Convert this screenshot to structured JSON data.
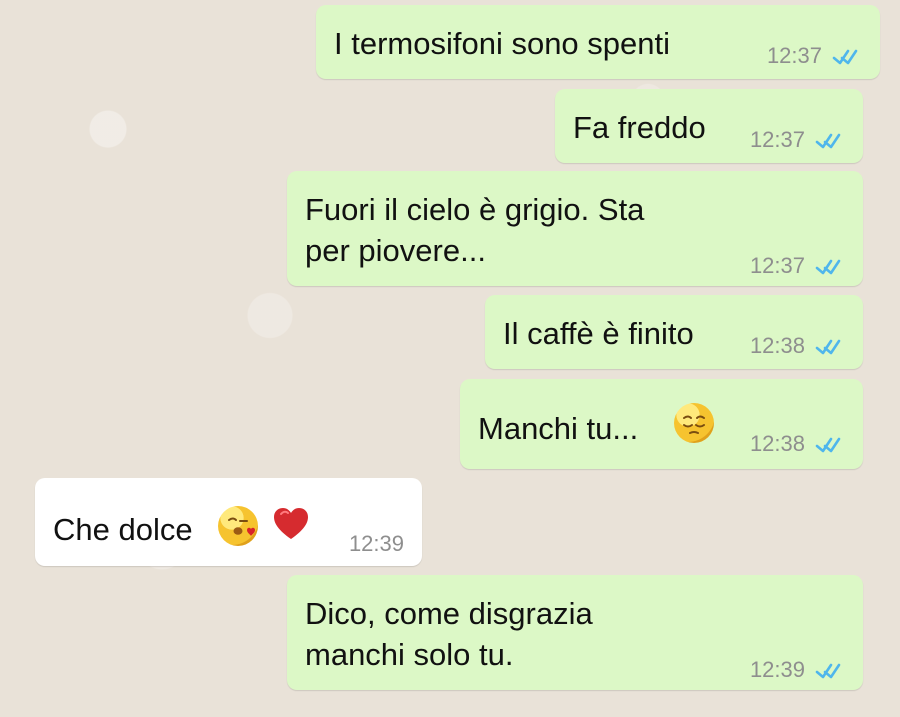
{
  "messages": [
    {
      "text": "I termosifoni sono spenti",
      "time": "12:37",
      "icon": "double-check-icon"
    },
    {
      "text": "Fa freddo",
      "time": "12:37",
      "icon": "double-check-icon"
    },
    {
      "line1": "Fuori il cielo è grigio. Sta",
      "line2": "per piovere...",
      "time": "12:37",
      "icon": "double-check-icon"
    },
    {
      "text": "Il caffè è finito",
      "time": "12:38",
      "icon": "double-check-icon"
    },
    {
      "text": "Manchi tu...",
      "time": "12:38",
      "emoji": "pensive-face-emoji",
      "icon": "double-check-icon"
    },
    {
      "text": "Che dolce",
      "time": "12:39",
      "emoji": [
        "kissing-heart-emoji",
        "red-heart-emoji"
      ]
    },
    {
      "line1": "Dico, come disgrazia",
      "line2": "manchi solo tu.",
      "time": "12:39",
      "icon": "double-check-icon"
    }
  ],
  "colors": {
    "outgoing_bubble": "#dcf8c6",
    "incoming_bubble": "#ffffff",
    "timestamp": "#8e8e8e",
    "read_ticks": "#4fb6ec",
    "chat_background": "#e9e2d8"
  }
}
